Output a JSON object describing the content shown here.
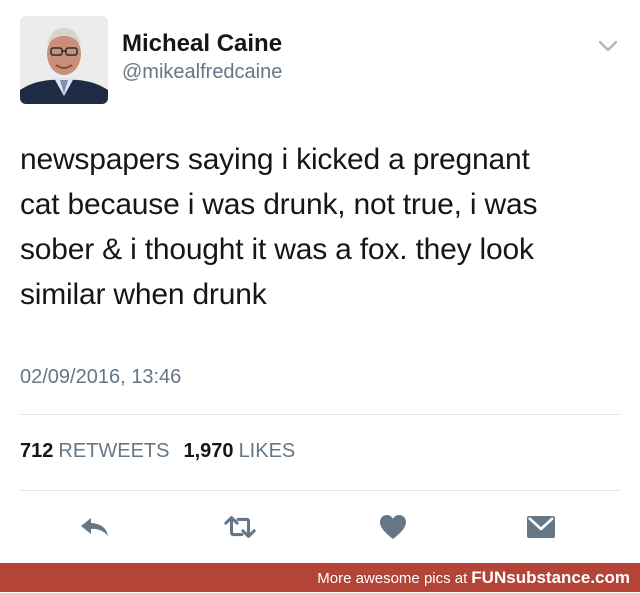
{
  "tweet": {
    "author": {
      "display_name": "Micheal Caine",
      "handle": "@mikealfredcaine",
      "avatar": "profile-photo"
    },
    "text": "newspapers saying i kicked a pregnant\ncat because i was drunk, not true, i was\nsober & i thought it was a fox. they look\nsimilar when drunk",
    "timestamp": "02/09/2016, 13:46",
    "stats": {
      "retweets_count": "712",
      "retweets_label": "RETWEETS",
      "likes_count": "1,970",
      "likes_label": "LIKES"
    },
    "actions": [
      "reply-icon",
      "retweet-icon",
      "like-icon",
      "direct-message-icon"
    ],
    "menu_icon": "chevron-down-icon"
  },
  "footer": {
    "text": "More awesome pics at",
    "brand": "FUNsubstance.com",
    "color": "#b44438"
  },
  "colors": {
    "primary_text": "#14171a",
    "secondary_text": "#657786",
    "icon": "#657786",
    "divider": "#e1e8ed"
  }
}
